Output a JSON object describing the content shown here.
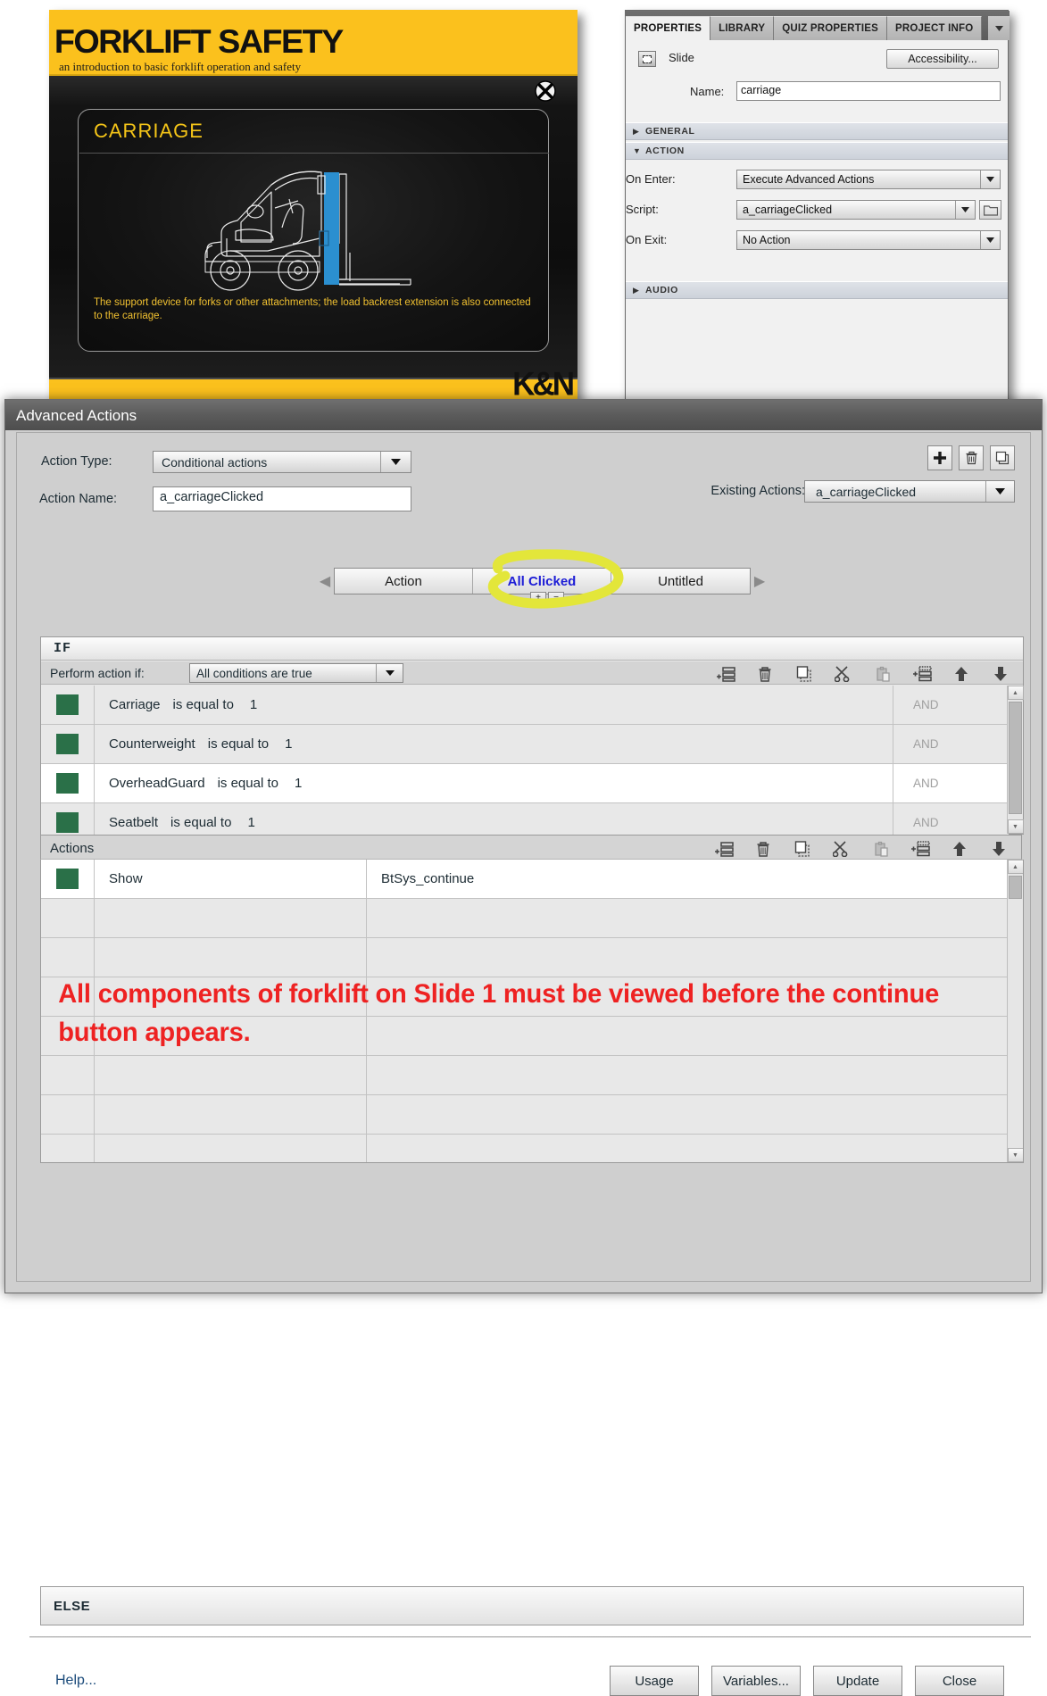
{
  "slide": {
    "title": "FORKLIFT SAFETY",
    "subtitle": "an introduction to basic forklift operation and safety",
    "card_title": "CARRIAGE",
    "card_caption": "The support device for forks or other attachments; the load backrest extension is also connected to the carriage.",
    "logo": "K&N",
    "close_icon": "close-x-icon",
    "colors": {
      "brand_yellow": "#fbc11d",
      "card_title": "#f5c518",
      "caption": "#f0c030",
      "highlight_blue": "#2b8fd0"
    }
  },
  "properties_panel": {
    "tabs": [
      {
        "label": "PROPERTIES",
        "active": true
      },
      {
        "label": "LIBRARY",
        "active": false
      },
      {
        "label": "QUIZ PROPERTIES",
        "active": false
      },
      {
        "label": "PROJECT INFO",
        "active": false
      }
    ],
    "overflow_icon": "chevron-down-icon",
    "object_type": "Slide",
    "object_icon": "slide-icon",
    "accessibility_button": "Accessibility...",
    "name_label": "Name:",
    "name_value": "carriage",
    "sections": [
      {
        "key": "general",
        "label": "GENERAL",
        "expanded": false,
        "arrow": "▶"
      },
      {
        "key": "action",
        "label": "ACTION",
        "expanded": true,
        "arrow": "▼"
      },
      {
        "key": "audio",
        "label": "AUDIO",
        "expanded": false,
        "arrow": "▶"
      }
    ],
    "action": {
      "on_enter_label": "On Enter:",
      "on_enter_value": "Execute Advanced Actions",
      "script_label": "Script:",
      "script_value": "a_carriageClicked",
      "folder_icon": "folder-icon",
      "on_exit_label": "On Exit:",
      "on_exit_value": "No Action"
    }
  },
  "advanced_actions": {
    "window_title": "Advanced Actions",
    "action_type_label": "Action Type:",
    "action_type_value": "Conditional actions",
    "action_name_label": "Action Name:",
    "action_name_value": "a_carriageClicked",
    "existing_actions_label": "Existing Actions:",
    "existing_actions_value": "a_carriageClicked",
    "top_icons": [
      {
        "name": "add-action-button",
        "icon": "plus-icon"
      },
      {
        "name": "delete-action-button",
        "icon": "trash-icon"
      },
      {
        "name": "duplicate-action-button",
        "icon": "duplicate-icon"
      }
    ],
    "tabs": [
      {
        "label": "Action",
        "selected": false
      },
      {
        "label": "All Clicked",
        "selected": true
      },
      {
        "label": "Untitled",
        "selected": false
      }
    ],
    "tab_prev_icon": "chevron-left-icon",
    "tab_next_icon": "chevron-right-icon",
    "tab_add_label": "+",
    "tab_remove_label": "−",
    "if_label": "IF",
    "perform_label": "Perform action if:",
    "perform_value": "All conditions are true",
    "condition_tools": [
      {
        "name": "add-condition-button",
        "icon": "add-row-icon"
      },
      {
        "name": "delete-condition-button",
        "icon": "trash-icon"
      },
      {
        "name": "copy-condition-button",
        "icon": "copy-icon"
      },
      {
        "name": "cut-condition-button",
        "icon": "scissors-icon"
      },
      {
        "name": "paste-condition-button",
        "icon": "paste-icon"
      },
      {
        "name": "insert-condition-button",
        "icon": "insert-row-icon"
      },
      {
        "name": "move-condition-up-button",
        "icon": "arrow-up-icon"
      },
      {
        "name": "move-condition-down-button",
        "icon": "arrow-down-icon"
      }
    ],
    "conditions": [
      {
        "variable": "Carriage",
        "operator": "is equal to",
        "value": "1",
        "join": "AND"
      },
      {
        "variable": "Counterweight",
        "operator": "is equal to",
        "value": "1",
        "join": "AND"
      },
      {
        "variable": "OverheadGuard",
        "operator": "is equal to",
        "value": "1",
        "join": "AND"
      },
      {
        "variable": "Seatbelt",
        "operator": "is equal to",
        "value": "1",
        "join": "AND"
      }
    ],
    "actions_label": "Actions",
    "action_tools": [
      {
        "name": "add-action-row-button",
        "icon": "add-row-icon"
      },
      {
        "name": "delete-action-row-button",
        "icon": "trash-icon"
      },
      {
        "name": "copy-action-row-button",
        "icon": "copy-icon"
      },
      {
        "name": "cut-action-row-button",
        "icon": "scissors-icon"
      },
      {
        "name": "paste-action-row-button",
        "icon": "paste-icon"
      },
      {
        "name": "insert-action-row-button",
        "icon": "insert-row-icon"
      },
      {
        "name": "move-action-up-button",
        "icon": "arrow-up-icon"
      },
      {
        "name": "move-action-down-button",
        "icon": "arrow-down-icon"
      }
    ],
    "action_rows": [
      {
        "command": "Show",
        "target": "BtSys_continue"
      },
      {
        "command": "",
        "target": ""
      },
      {
        "command": "",
        "target": ""
      },
      {
        "command": "",
        "target": ""
      },
      {
        "command": "",
        "target": ""
      },
      {
        "command": "",
        "target": ""
      },
      {
        "command": "",
        "target": ""
      },
      {
        "command": "",
        "target": ""
      }
    ],
    "else_label": "ELSE",
    "help_label": "Help...",
    "footer_buttons": [
      {
        "label": "Usage"
      },
      {
        "label": "Variables..."
      },
      {
        "label": "Update"
      },
      {
        "label": "Close"
      }
    ]
  },
  "annotation": {
    "text": "All components of forklift on Slide 1 must be viewed before the continue button appears.",
    "color": "#ee2222",
    "highlight_color": "#e3e63a"
  }
}
